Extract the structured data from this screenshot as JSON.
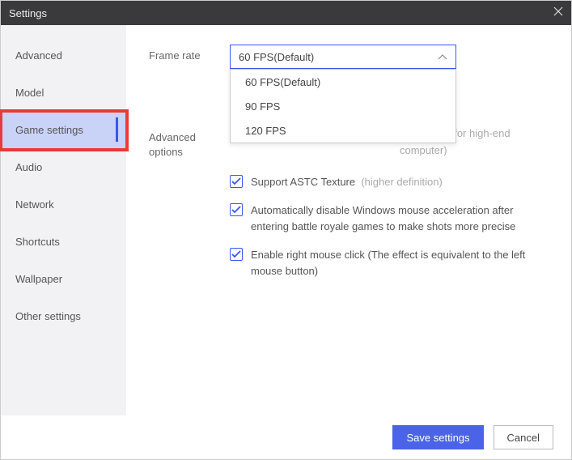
{
  "window": {
    "title": "Settings"
  },
  "sidebar": {
    "items": [
      {
        "label": "Advanced"
      },
      {
        "label": "Model"
      },
      {
        "label": "Game settings"
      },
      {
        "label": "Audio"
      },
      {
        "label": "Network"
      },
      {
        "label": "Shortcuts"
      },
      {
        "label": "Wallpaper"
      },
      {
        "label": "Other settings"
      }
    ],
    "active_index": 2
  },
  "frame_rate": {
    "label": "Frame rate",
    "value": "60 FPS(Default)",
    "options": [
      "60 FPS(Default)",
      "90 FPS",
      "120 FPS"
    ]
  },
  "advanced_options": {
    "label": "Advanced options",
    "trailing_visible": "g",
    "trailing_hint": "(suitable for high-end computer)"
  },
  "checks": {
    "astc": {
      "label": "Support ASTC Texture",
      "hint": "(higher definition)",
      "checked": true
    },
    "mouse_accel": {
      "label": "Automatically disable Windows mouse acceleration after entering battle royale games to make shots more precise",
      "checked": true
    },
    "right_click": {
      "label": "Enable right mouse click (The effect is equivalent to the left mouse button)",
      "checked": true
    }
  },
  "footer": {
    "save": "Save settings",
    "cancel": "Cancel"
  }
}
